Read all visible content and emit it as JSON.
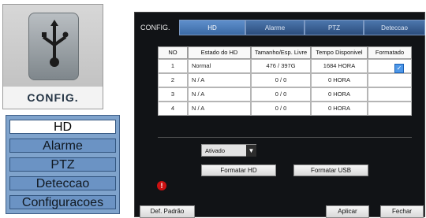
{
  "icon_tile": {
    "label": "CONFIG.",
    "icon": "usb-drive-icon"
  },
  "side_menu": [
    {
      "label": "HD",
      "active": true
    },
    {
      "label": "Alarme",
      "active": false
    },
    {
      "label": "PTZ",
      "active": false
    },
    {
      "label": "Deteccao",
      "active": false
    },
    {
      "label": "Configuracoes",
      "active": false
    }
  ],
  "dialog": {
    "title": "CONFIG.",
    "tabs": [
      "HD",
      "Alarme",
      "PTZ",
      "Deteccao"
    ],
    "active_tab": "HD",
    "table": {
      "headers": [
        "NO",
        "Estado do HD",
        "Tamanho/Esp. Livre",
        "Tempo Disponivel",
        "Formatado"
      ],
      "rows": [
        [
          "1",
          "Normal",
          "476 / 397G",
          "1684 HORA",
          "checked"
        ],
        [
          "2",
          "N / A",
          "0 / 0",
          "0 HORA",
          ""
        ],
        [
          "3",
          "N / A",
          "0 / 0",
          "0 HORA",
          ""
        ],
        [
          "4",
          "N / A",
          "0 / 0",
          "0 HORA",
          ""
        ]
      ]
    },
    "mode": {
      "value": "Ativado"
    },
    "buttons": {
      "format_hd": "Formatar HD",
      "format_usb": "Formatar USB",
      "default": "Def. Padrão",
      "apply": "Aplicar",
      "close": "Fechar"
    }
  },
  "colors": {
    "dialog_bg": "#111316",
    "tab_active": "#5f8fcc",
    "menu_bg": "#7fa3cc",
    "warning": "#cc1111"
  }
}
